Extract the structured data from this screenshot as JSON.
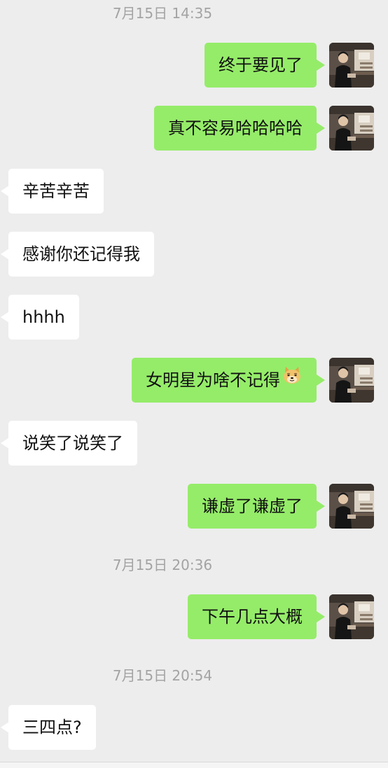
{
  "chat": {
    "timestamps": {
      "t1": "7月15日 14:35",
      "t2": "7月15日 20:36",
      "t3": "7月15日 20:54"
    },
    "messages": {
      "m1": "终于要见了",
      "m2": "真不容易哈哈哈哈",
      "m3": "辛苦辛苦",
      "m4": "感谢你还记得我",
      "m5": "hhhh",
      "m6": "女明星为啥不记得",
      "m7": "说笑了说笑了",
      "m8": "谦虚了谦虚了",
      "m9": "下午几点大概",
      "m10": "三四点?"
    },
    "emoji": "doge-emoji"
  },
  "colors": {
    "background": "#ededed",
    "outgoing_bubble": "#95ec69",
    "incoming_bubble": "#ffffff",
    "timestamp_text": "#a3a3a3"
  }
}
